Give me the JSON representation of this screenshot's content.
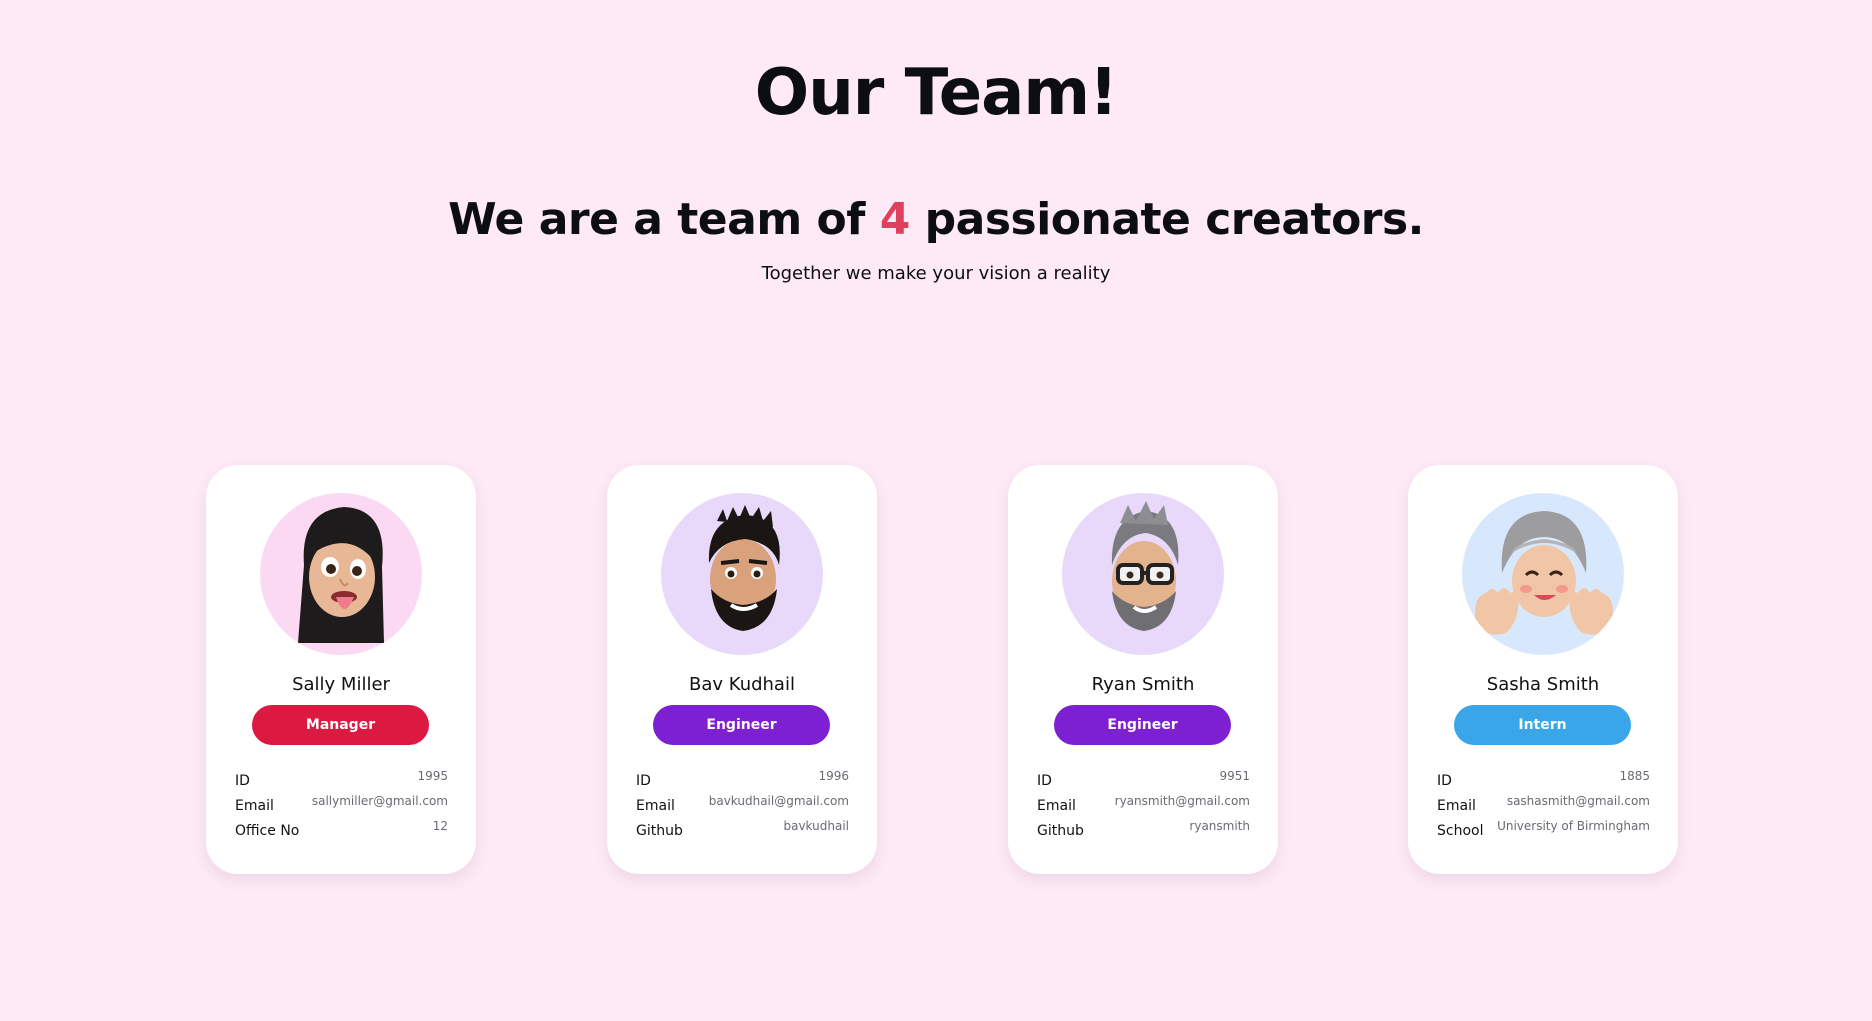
{
  "header": {
    "title": "Our Team!",
    "subtitle_prefix": "We are a team of ",
    "team_count": "4",
    "subtitle_suffix": " passionate creators.",
    "tagline": "Together we make your vision a reality"
  },
  "colors": {
    "background": "#fdeaf6",
    "accent": "#e0405d",
    "manager": "#dc1941",
    "engineer": "#7c20d2",
    "intern": "#3aa6ea"
  },
  "members": [
    {
      "name": "Sally Miller",
      "role": "Manager",
      "avatar_icon": "memoji-woman-tongue-out-icon",
      "fields": [
        {
          "label": "ID",
          "value": "1995"
        },
        {
          "label": "Email",
          "value": "sallymiller@gmail.com"
        },
        {
          "label": "Office No",
          "value": "12"
        }
      ]
    },
    {
      "name": "Bav Kudhail",
      "role": "Engineer",
      "avatar_icon": "memoji-man-beard-icon",
      "fields": [
        {
          "label": "ID",
          "value": "1996"
        },
        {
          "label": "Email",
          "value": "bavkudhail@gmail.com"
        },
        {
          "label": "Github",
          "value": "bavkudhail"
        }
      ]
    },
    {
      "name": "Ryan Smith",
      "role": "Engineer",
      "avatar_icon": "memoji-man-glasses-icon",
      "fields": [
        {
          "label": "ID",
          "value": "9951"
        },
        {
          "label": "Email",
          "value": "ryansmith@gmail.com"
        },
        {
          "label": "Github",
          "value": "ryansmith"
        }
      ]
    },
    {
      "name": "Sasha Smith",
      "role": "Intern",
      "avatar_icon": "memoji-woman-headscarf-icon",
      "fields": [
        {
          "label": "ID",
          "value": "1885"
        },
        {
          "label": "Email",
          "value": "sashasmith@gmail.com"
        },
        {
          "label": "School",
          "value": "University of Birmingham"
        }
      ]
    }
  ]
}
